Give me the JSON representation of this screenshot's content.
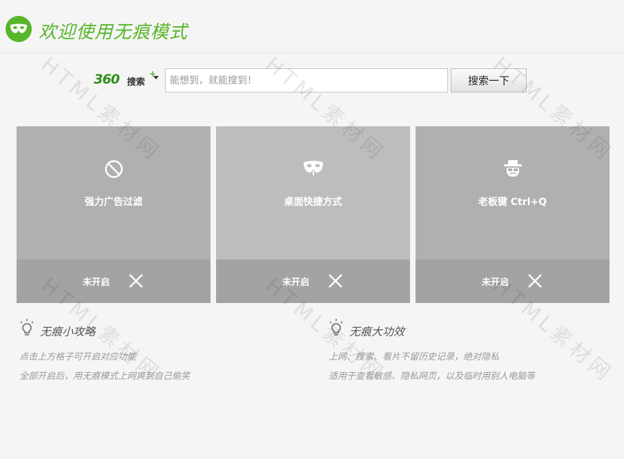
{
  "header": {
    "title": "欢迎使用无痕模式",
    "logo_icon": "incognito-mask-icon"
  },
  "search": {
    "brand_360": "360",
    "brand_cn": "搜索",
    "brand_plus": "+",
    "placeholder": "能想到，就能搜到！",
    "value": "",
    "button_label": "搜索一下"
  },
  "cards": [
    {
      "title": "强力广告过滤",
      "state": "未开启",
      "icon": "ad-block-icon",
      "top_color": "#b0b0b0"
    },
    {
      "title": "桌面快捷方式",
      "state": "未开启",
      "icon": "mask-icon",
      "top_color": "#bdbdbd"
    },
    {
      "title": "老板键 Ctrl+Q",
      "state": "未开启",
      "icon": "boss-key-icon",
      "top_color": "#b0b0b0"
    }
  ],
  "tips": [
    {
      "title": "无痕小攻略",
      "lines": [
        "点击上方格子可开启对应功能",
        "全部开启后，用无痕模式上网爽到自己偷笑"
      ]
    },
    {
      "title": "无痕大功效",
      "lines": [
        "上网、搜索、看片不留历史记录，绝对隐私",
        "适用于查看敏感、隐私网页，以及临时用别人电脑等"
      ]
    }
  ],
  "watermark": "HTML素材网",
  "colors": {
    "accent": "#57b62a",
    "card_bottom": "#a3a3a3",
    "background": "#f5f5f5"
  }
}
